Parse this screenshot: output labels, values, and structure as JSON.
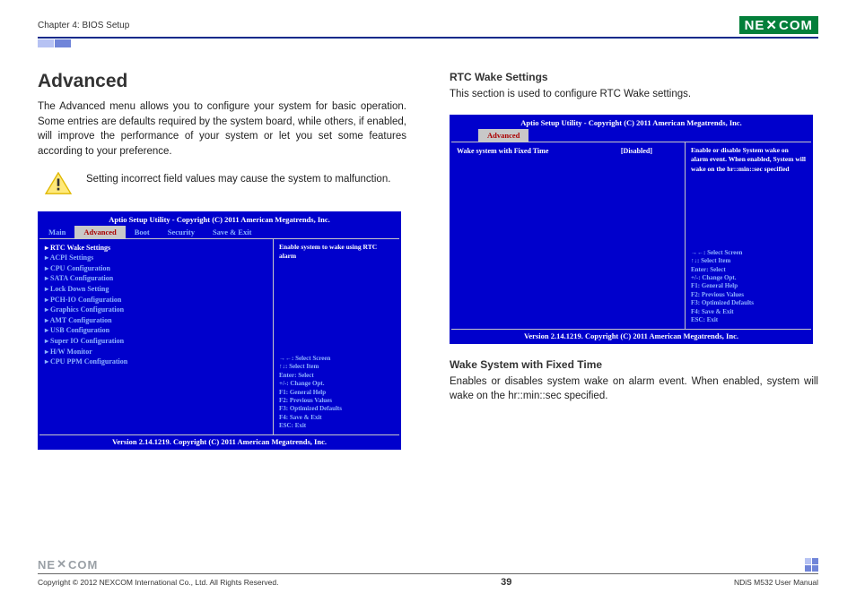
{
  "header": {
    "chapter": "Chapter 4: BIOS Setup",
    "brand": "NEXCOM"
  },
  "left": {
    "title": "Advanced",
    "intro": "The Advanced menu allows you to configure your system for basic operation. Some entries are defaults required by the system board, while others, if enabled, will improve the performance of your system or let you set some features according to your preference.",
    "warning": "Setting incorrect field values may cause the system to malfunction.",
    "bios": {
      "title": "Aptio Setup Utility - Copyright (C) 2011 American Megatrends, Inc.",
      "tabs": {
        "main": "Main",
        "advanced": "Advanced",
        "boot": "Boot",
        "security": "Security",
        "save": "Save & Exit"
      },
      "items": [
        "RTC Wake Settings",
        "ACPI Settings",
        "CPU Configuration",
        "SATA Configuration",
        "Lock Down Setting",
        "PCH-IO Configuration",
        "Graphics Configuration",
        "AMT Configuration",
        "USB Configuration",
        "Super IO Configuration",
        "H/W Monitor",
        "CPU PPM Configuration"
      ],
      "help": "Enable system to wake using RTC alarm",
      "nav": "→←: Select Screen\n↑↓: Select Item\nEnter: Select\n+/-: Change Opt.\nF1: General Help\nF2: Previous Values\nF3: Optimized Defaults\nF4: Save & Exit\nESC: Exit",
      "footer": "Version 2.14.1219. Copyright (C) 2011 American Megatrends, Inc."
    }
  },
  "right": {
    "h2a": "RTC Wake Settings",
    "p1": "This section is used to configure RTC Wake settings.",
    "bios": {
      "title": "Aptio Setup Utility - Copyright (C) 2011 American Megatrends, Inc.",
      "tab": "Advanced",
      "row_label": "Wake system with Fixed Time",
      "row_value": "[Disabled]",
      "help": "Enable or disable System wake on alarm event. When enabled, System will wake on the hr::min::sec specified",
      "nav": "→←: Select Screen\n↑↓: Select Item\nEnter: Select\n+/-: Change Opt.\nF1: General Help\nF2: Previous Values\nF3: Optimized Defaults\nF4: Save & Exit\nESC: Exit",
      "footer": "Version 2.14.1219. Copyright (C) 2011 American Megatrends, Inc."
    },
    "h2b": "Wake System with Fixed Time",
    "p2": "Enables or disables system wake on alarm event. When enabled, system will wake on the hr::min::sec specified."
  },
  "footer": {
    "copyright": "Copyright © 2012 NEXCOM International Co., Ltd. All Rights Reserved.",
    "page": "39",
    "doc": "NDiS M532 User Manual"
  }
}
